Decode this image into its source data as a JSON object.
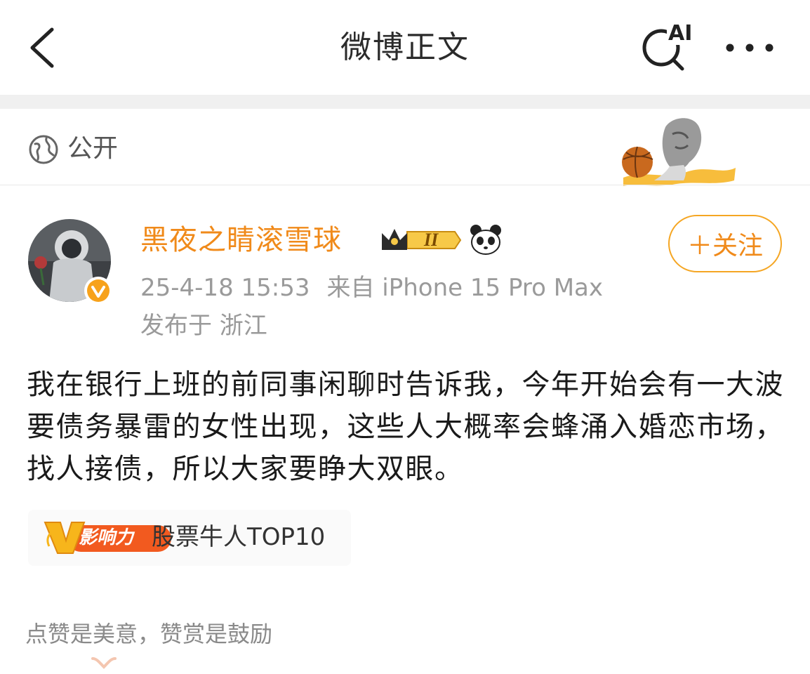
{
  "header": {
    "title": "微博正文",
    "back_icon": "chevron-left-icon",
    "ai_search_icon": "ai-search-icon",
    "ai_label": "AI",
    "more_icon": "more-dots-icon"
  },
  "post": {
    "visibility_icon": "globe-icon",
    "visibility": "公开",
    "author": {
      "name": "黑夜之睛滚雪球",
      "level": "II",
      "verified_icon": "verified-v-icon"
    },
    "follow_label": "＋关注",
    "timestamp": "25-4-18 15:53",
    "source": "来自 iPhone 15 Pro Max",
    "location": "发布于 浙江",
    "content": "我在银行上班的前同事闲聊时告诉我，今年开始会有一大波要债务暴雷的女性出现，这些人大概率会蜂涌入婚恋市场，找人接债，所以大家要睁大双眼。",
    "influence": {
      "badge_label": "影响力",
      "text": "股票牛人TOP10"
    },
    "reward_text": "点赞是美意，赞赏是鼓励"
  },
  "colors": {
    "accent": "#f08a1a",
    "follow_border": "#f5a623",
    "meta_gray": "#9a9a9a"
  }
}
